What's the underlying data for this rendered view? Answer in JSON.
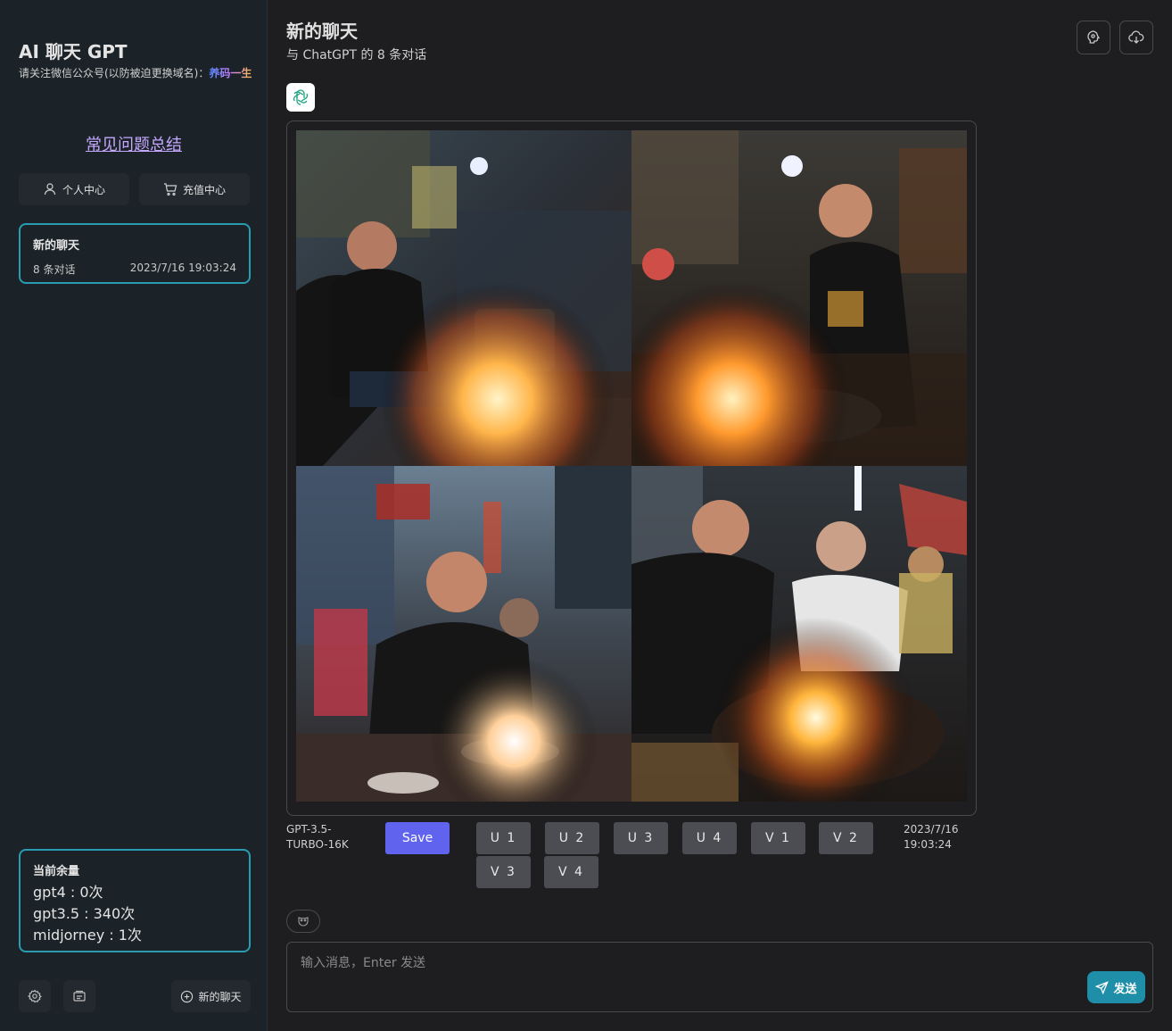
{
  "sidebar": {
    "app_title": "AI 聊天 GPT",
    "notice_prefix": "请关注微信公众号(以防被迫更换域名)：",
    "notice_brand": "养码一生",
    "faq_link": "常见问题总结",
    "personal_center": "个人中心",
    "recharge_center": "充值中心",
    "chat_item": {
      "title": "新的聊天",
      "count": "8 条对话",
      "time": "2023/7/16 19:03:24"
    },
    "balance": {
      "title": "当前余量",
      "gpt4": "gpt4 : 0次",
      "gpt35": "gpt3.5 : 340次",
      "midjourney": "midjorney : 1次"
    },
    "new_chat_label": "新的聊天",
    "icons": {
      "settings": "settings-icon",
      "library": "library-icon",
      "new_chat": "plus-circle-icon"
    }
  },
  "header": {
    "title": "新的聊天",
    "subtitle": "与 ChatGPT 的 8 条对话",
    "icons": [
      "prompt-icon",
      "download-icon"
    ]
  },
  "message": {
    "avatar_icon": "openai-logo-icon",
    "model": "GPT-3.5-TURBO-16K",
    "time": "2023/7/16 19:03:24",
    "save_label": "Save",
    "actions": [
      "U 1",
      "U 2",
      "U 3",
      "U 4",
      "V 1",
      "V 2",
      "V 3",
      "V 4"
    ]
  },
  "composer": {
    "placeholder": "输入消息，Enter 发送",
    "send_label": "发送",
    "emoji_icon": "mask-icon"
  },
  "colors": {
    "accent": "#2a9cb1",
    "send": "#1f8ea8",
    "save": "#6063ee",
    "faq_link": "#c4a7ff"
  }
}
